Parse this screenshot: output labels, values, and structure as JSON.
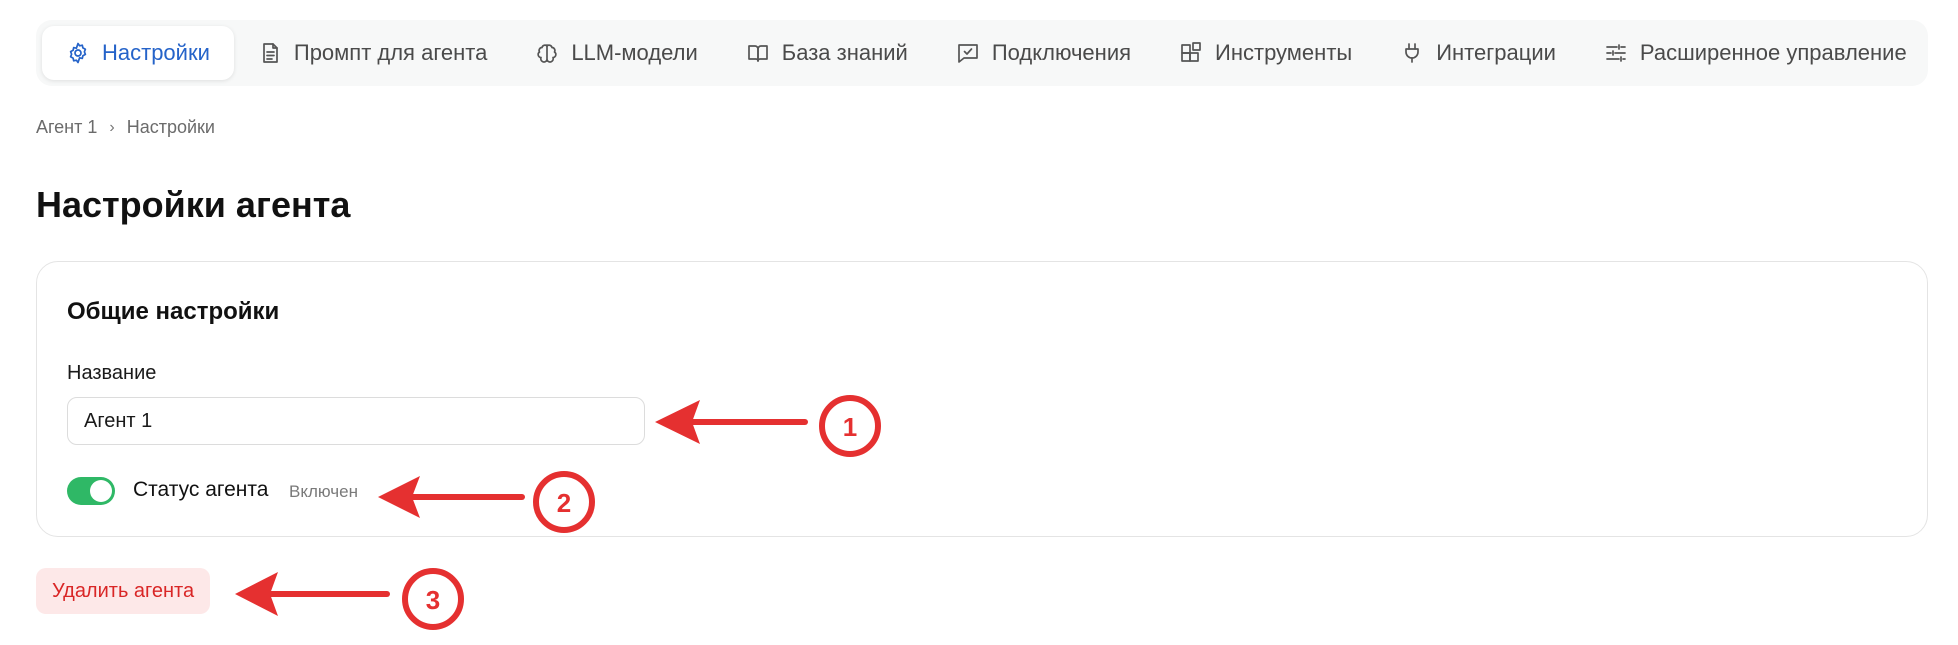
{
  "tabs": [
    {
      "label": "Настройки",
      "icon": "gear-icon",
      "active": true
    },
    {
      "label": "Промпт для агента",
      "icon": "document-icon"
    },
    {
      "label": "LLM-модели",
      "icon": "brain-icon"
    },
    {
      "label": "База знаний",
      "icon": "book-icon"
    },
    {
      "label": "Подключения",
      "icon": "chat-check-icon"
    },
    {
      "label": "Инструменты",
      "icon": "blocks-icon"
    },
    {
      "label": "Интеграции",
      "icon": "plug-icon"
    },
    {
      "label": "Расширенное управление",
      "icon": "sliders-icon"
    }
  ],
  "breadcrumb": {
    "parent": "Агент 1",
    "separator": "›",
    "current": "Настройки"
  },
  "page_title": "Настройки агента",
  "general": {
    "title": "Общие настройки",
    "name_label": "Название",
    "name_value": "Агент 1",
    "status_label": "Статус агента",
    "status_value": "Включен",
    "status_on": true
  },
  "delete_label": "Удалить агента",
  "annotations": {
    "color": "#e53030",
    "markers": [
      "1",
      "2",
      "3"
    ]
  },
  "colors": {
    "accent": "#2563c9",
    "toggle_on": "#2fb866",
    "danger": "#d92626",
    "danger_bg": "#fde8e8"
  }
}
